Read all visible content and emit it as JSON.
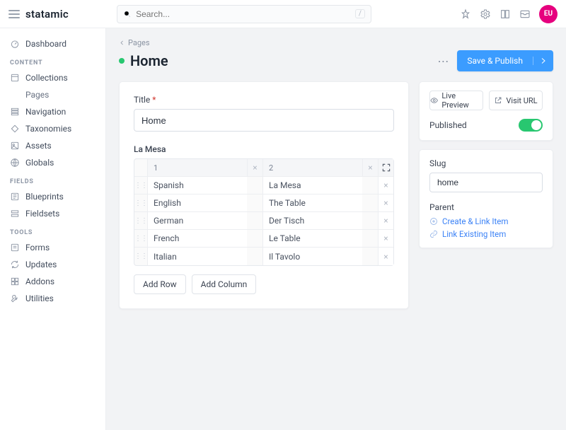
{
  "brand": "statamic",
  "search": {
    "placeholder": "Search..."
  },
  "avatar_initials": "EU",
  "sidebar": {
    "dashboard": "Dashboard",
    "groups": [
      {
        "head": "CONTENT",
        "items": [
          {
            "name": "collections",
            "label": "Collections",
            "sub": false
          },
          {
            "name": "pages",
            "label": "Pages",
            "sub": true
          },
          {
            "name": "navigation",
            "label": "Navigation",
            "sub": false
          },
          {
            "name": "taxonomies",
            "label": "Taxonomies",
            "sub": false
          },
          {
            "name": "assets",
            "label": "Assets",
            "sub": false
          },
          {
            "name": "globals",
            "label": "Globals",
            "sub": false
          }
        ]
      },
      {
        "head": "FIELDS",
        "items": [
          {
            "name": "blueprints",
            "label": "Blueprints",
            "sub": false
          },
          {
            "name": "fieldsets",
            "label": "Fieldsets",
            "sub": false
          }
        ]
      },
      {
        "head": "TOOLS",
        "items": [
          {
            "name": "forms",
            "label": "Forms",
            "sub": false
          },
          {
            "name": "updates",
            "label": "Updates",
            "sub": false
          },
          {
            "name": "addons",
            "label": "Addons",
            "sub": false
          },
          {
            "name": "utilities",
            "label": "Utilities",
            "sub": false
          }
        ]
      }
    ]
  },
  "breadcrumb": "Pages",
  "page_title": "Home",
  "actions": {
    "save": "Save & Publish"
  },
  "form": {
    "title_label": "Title",
    "title_value": "Home",
    "grid_label": "La Mesa",
    "col_headers": [
      "1",
      "2"
    ],
    "rows": [
      {
        "a": "Spanish",
        "b": "La Mesa"
      },
      {
        "a": "English",
        "b": "The Table"
      },
      {
        "a": "German",
        "b": "Der Tisch"
      },
      {
        "a": "French",
        "b": "Le Table"
      },
      {
        "a": "Italian",
        "b": "Il Tavolo"
      }
    ],
    "add_row": "Add Row",
    "add_col": "Add Column"
  },
  "side": {
    "live_preview": "Live Preview",
    "visit_url": "Visit URL",
    "published_label": "Published",
    "slug_label": "Slug",
    "slug_value": "home",
    "parent_label": "Parent",
    "create_link": "Create & Link Item",
    "link_existing": "Link Existing Item"
  }
}
